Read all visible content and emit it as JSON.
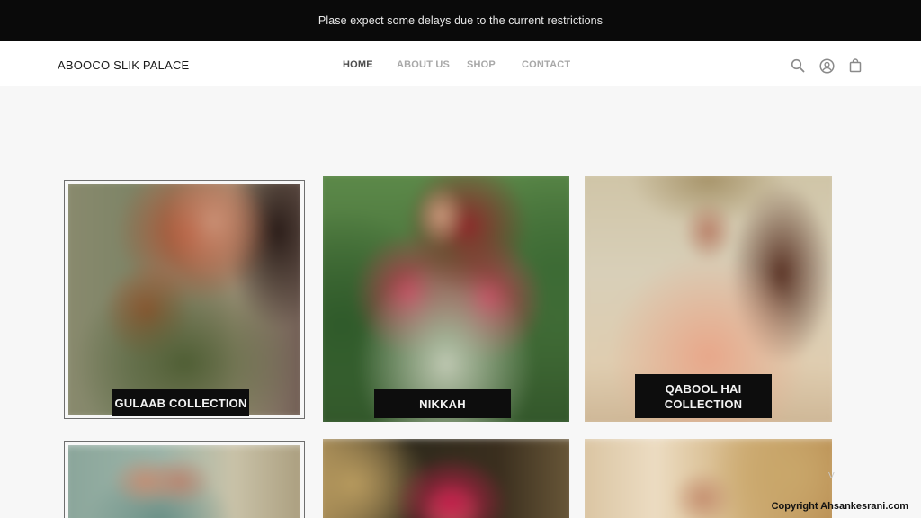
{
  "announcement": "Plase expect some delays due to the current restrictions",
  "header": {
    "brand": "ABOOCO SLIK PALACE",
    "nav": [
      {
        "label": "HOME",
        "active": true
      },
      {
        "label": "ABOUT US",
        "active": false
      },
      {
        "label": "SHOP",
        "active": false
      },
      {
        "label": "CONTACT",
        "active": false
      }
    ],
    "icons": [
      "search-icon",
      "account-icon",
      "cart-bag-icon"
    ]
  },
  "collections": [
    {
      "title": "GULAAB COLLECTION"
    },
    {
      "title": "NIKKAH"
    },
    {
      "title_line1": "QABOOL HAI",
      "title_line2": "COLLECTION"
    }
  ],
  "colors": {
    "announcement_bg": "#0a0a0a",
    "header_bg": "#ffffff",
    "page_bg": "#f7f7f7",
    "nav_active": "#4d4d4d",
    "nav_inactive": "#a8a8a8",
    "label_bg": "#0d0d0d"
  },
  "copyright": "Copyright Ahsankesrani.com"
}
